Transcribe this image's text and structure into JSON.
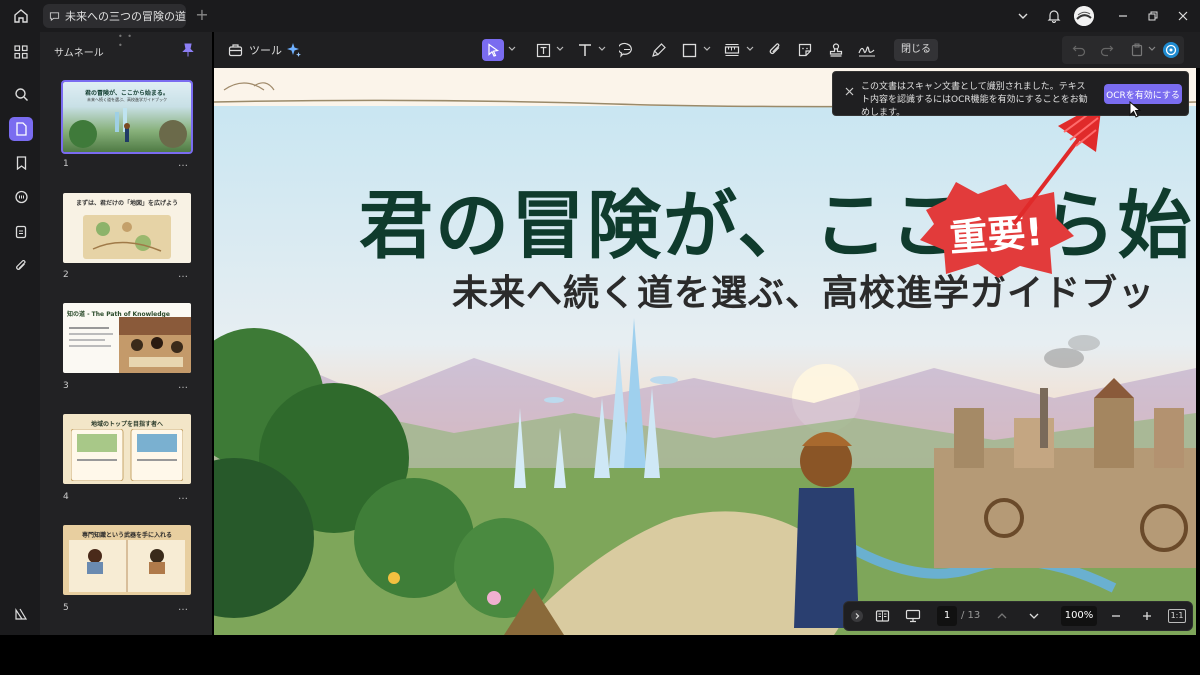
{
  "tab": {
    "title": "未来への三つの冒険の道"
  },
  "toolbar": {
    "tools_label": "ツール",
    "close_label": "閉じる"
  },
  "sidebar": {
    "title": "サムネール"
  },
  "thumbnails": [
    {
      "number": "1",
      "title": "君の冒険が、ここから始まる。",
      "subtitle": "未来へ続く道を選ぶ、高校進学ガイドブック"
    },
    {
      "number": "2",
      "title": "まずは、君だけの「地図」を広げよう",
      "subtitle": ""
    },
    {
      "number": "3",
      "title": "知の道 - The Path of Knowledge",
      "subtitle": ""
    },
    {
      "number": "4",
      "title": "地域のトップを目指す者へ",
      "subtitle": ""
    },
    {
      "number": "5",
      "title": "専門知識という武器を手に入れる",
      "subtitle": ""
    }
  ],
  "thumb_more": "…",
  "canvas": {
    "title": "君の冒険が、ここから始ま",
    "subtitle": "未来へ続く道を選ぶ、高校進学ガイドブッ",
    "stamp": "重要!"
  },
  "ocr": {
    "message": "この文書はスキャン文書として識別されました。テキスト内容を認識するにはOCR機能を有効にすることをお勧めします。",
    "button": "OCRを有効にする"
  },
  "nav": {
    "page": "1",
    "total": "/ 13",
    "zoom": "100%",
    "fit": "1:1"
  },
  "colors": {
    "accent": "#7a6cf0",
    "title_green": "#0f3b2d",
    "stamp_red": "#e03a3a"
  }
}
